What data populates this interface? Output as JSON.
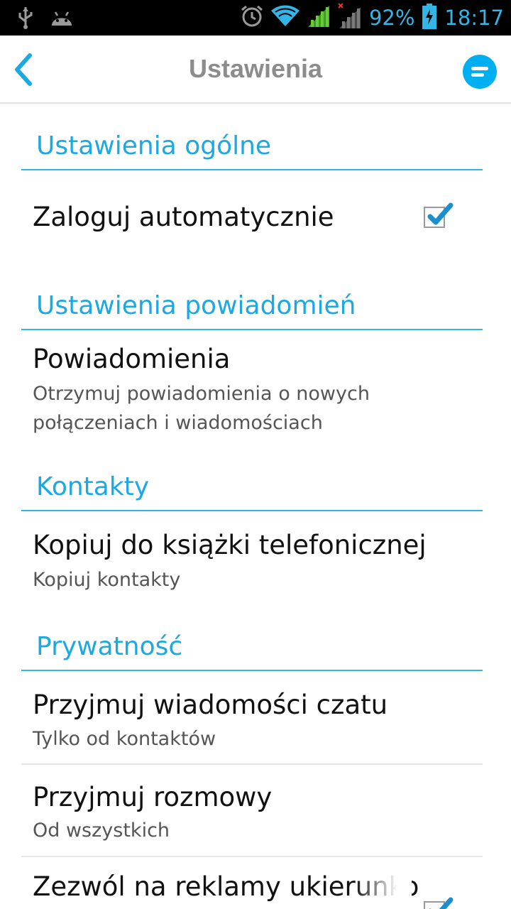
{
  "status_bar": {
    "battery": "92%",
    "time": "18:17",
    "icons": [
      "usb-icon",
      "android-debug-icon",
      "alarm-icon",
      "wifi-icon",
      "signal-icon",
      "signal-no-service-icon",
      "battery-charging-icon"
    ]
  },
  "action_bar": {
    "title": "Ustawienia",
    "back_icon": "chevron-left-icon",
    "menu_icon": "menu-icon",
    "accent": "#00aff0"
  },
  "sections": {
    "general": {
      "header": "Ustawienia ogólne",
      "auto_login": {
        "title": "Zaloguj automatycznie",
        "checked": true
      }
    },
    "notifications": {
      "header": "Ustawienia powiadomień",
      "notifications": {
        "title": "Powiadomienia",
        "subtitle": "Otrzymuj powiadomienia o nowych połączeniach i wiadomościach"
      }
    },
    "contacts": {
      "header": "Kontakty",
      "copy": {
        "title": "Kopiuj do książki telefonicznej",
        "subtitle": "Kopiuj kontakty"
      }
    },
    "privacy": {
      "header": "Prywatność",
      "chat": {
        "title": "Przyjmuj wiadomości czatu",
        "subtitle": "Tylko od kontaktów"
      },
      "calls": {
        "title": "Przyjmuj rozmowy",
        "subtitle": "Od wszystkich"
      },
      "ads": {
        "title": "Zezwól na reklamy ukierunko",
        "checked": true
      }
    }
  },
  "colors": {
    "header_blue": "#1ca8e0",
    "divider_blue": "#33b5e5",
    "check_blue": "#1a8fd0"
  }
}
